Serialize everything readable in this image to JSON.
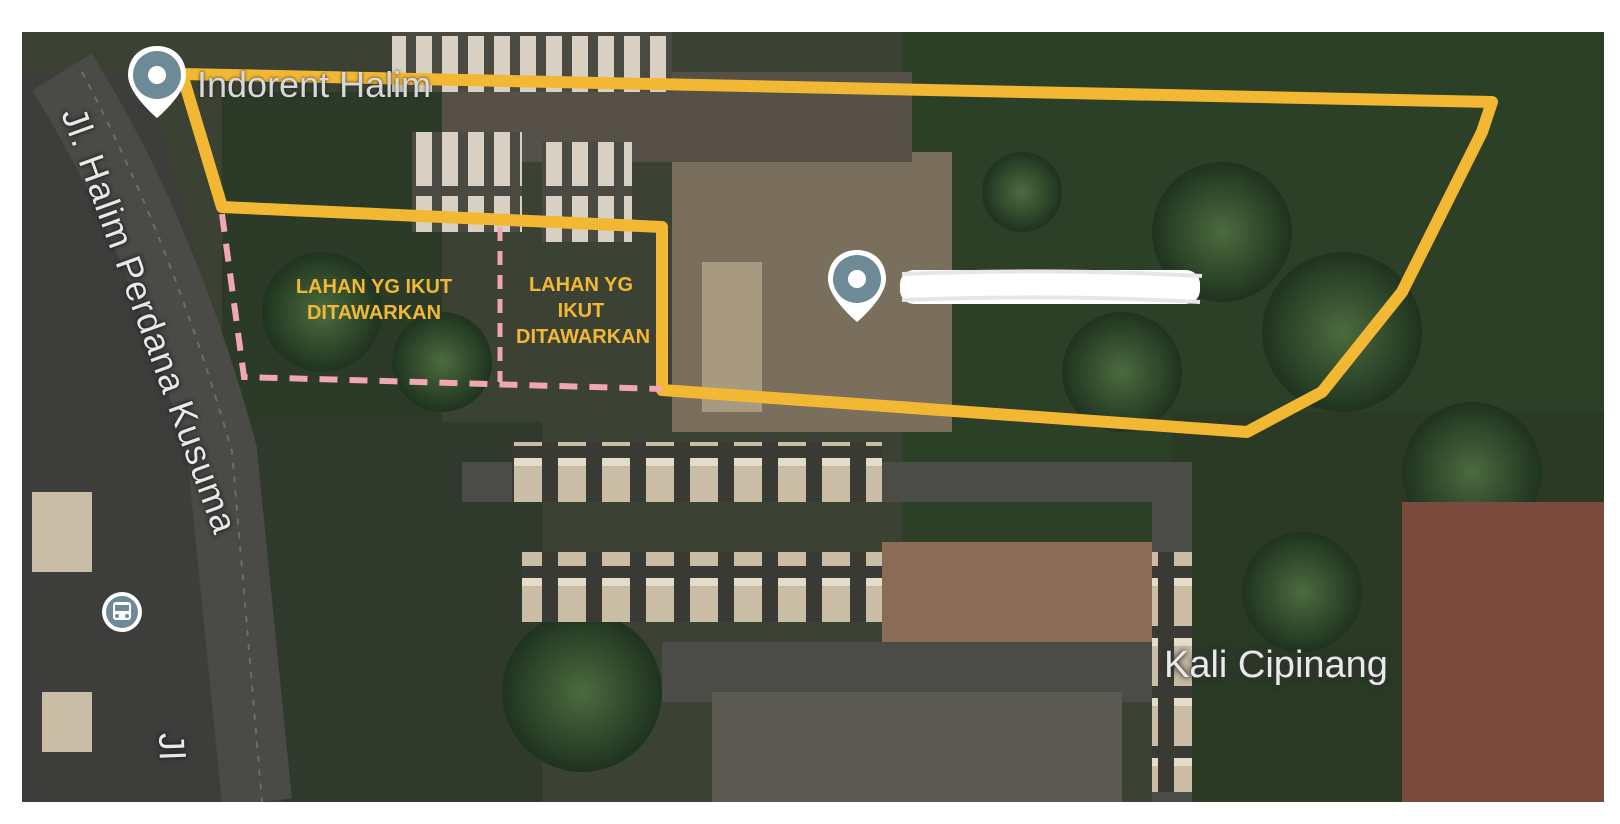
{
  "map": {
    "road_label": "Jl. Halim Perdana Kusuma",
    "road_label_bottom": "Jl",
    "poi_label": "Indorent Halim",
    "place_label": "Kali Cipinang",
    "redacted_label": "",
    "parcels": [
      {
        "label": "LAHAN YG IKUT DITAWARKAN"
      },
      {
        "label": "LAHAN YG IKUT DITAWARKAN"
      }
    ],
    "colors": {
      "boundary": "#f3b833",
      "dashed_boundary": "#f2a6b3",
      "marker": "#6e8a96",
      "vegetation": "#2e4a2a",
      "ground": "#6a5f4f"
    },
    "icons": [
      "location-pin-icon",
      "bus-stop-icon"
    ]
  }
}
